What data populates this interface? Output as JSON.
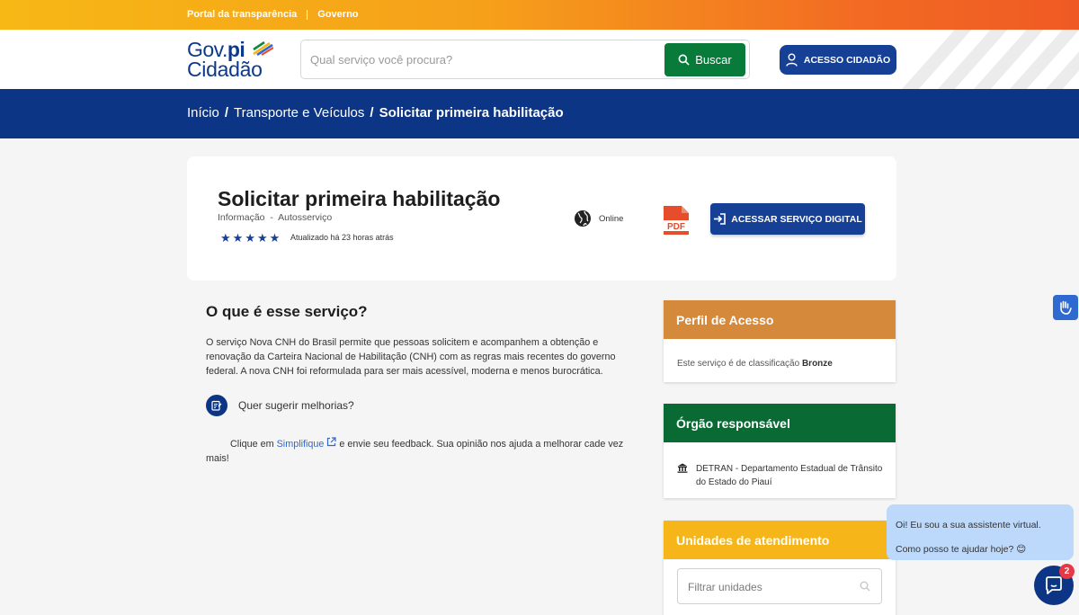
{
  "topbar": {
    "link1": "Portal da transparência",
    "link2": "Governo"
  },
  "header": {
    "logo_gov": "Gov.",
    "logo_pi": "pi",
    "logo_cidadao": "Cidadão",
    "search_placeholder": "Qual serviço você procura?",
    "search_button": "Buscar",
    "login_button": "ACESSO CIDADÃO"
  },
  "breadcrumb": {
    "home": "Início",
    "category": "Transporte e Veículos",
    "current": "Solicitar primeira habilitação"
  },
  "service": {
    "title": "Solicitar primeira habilitação",
    "meta": "Informação  -  Autosserviço",
    "rating": 5,
    "updated": "Atualizado há 23 horas atrás",
    "channel": "Online",
    "pdf_label": "PDF",
    "access_button": "ACESSAR SERVIÇO DIGITAL"
  },
  "about": {
    "title": "O que é esse serviço?",
    "text": "O serviço Nova CNH do Brasil permite que pessoas solicitem e acompanhem a obtenção e renovação da Carteira Nacional de Habilitação (CNH) com as regras mais recentes do governo federal. A nova CNH foi reformulada para ser mais acessível, moderna e menos burocrática.",
    "suggest_label": "Quer sugerir melhorias?",
    "feedback_before": "Clique em ",
    "feedback_link": "Simplifique",
    "feedback_after": " e envie seu feedback. Sua opinião nos ajuda a melhorar cade vez mais!"
  },
  "sidebar": {
    "perfil_title": "Perfil de Acesso",
    "perfil_text": "Este serviço é de classificação ",
    "perfil_level": "Bronze",
    "orgao_title": "Órgão responsável",
    "orgao_text": "DETRAN - Departamento Estadual de Trânsito do Estado do Piauí",
    "unidades_title": "Unidades de atendimento",
    "filter_placeholder": "Filtrar unidades"
  },
  "chat": {
    "line1": "Oi! Eu sou a sua assistente virtual.",
    "line2": "Como posso te ajudar hoje? 😊",
    "badge": "2"
  },
  "colors": {
    "primary_blue": "#0c3585",
    "button_blue": "#163f96",
    "green": "#087a3a",
    "orange_header": "#d5893b",
    "yellow_header": "#f6b61a",
    "pdf_red": "#e74c2b"
  }
}
